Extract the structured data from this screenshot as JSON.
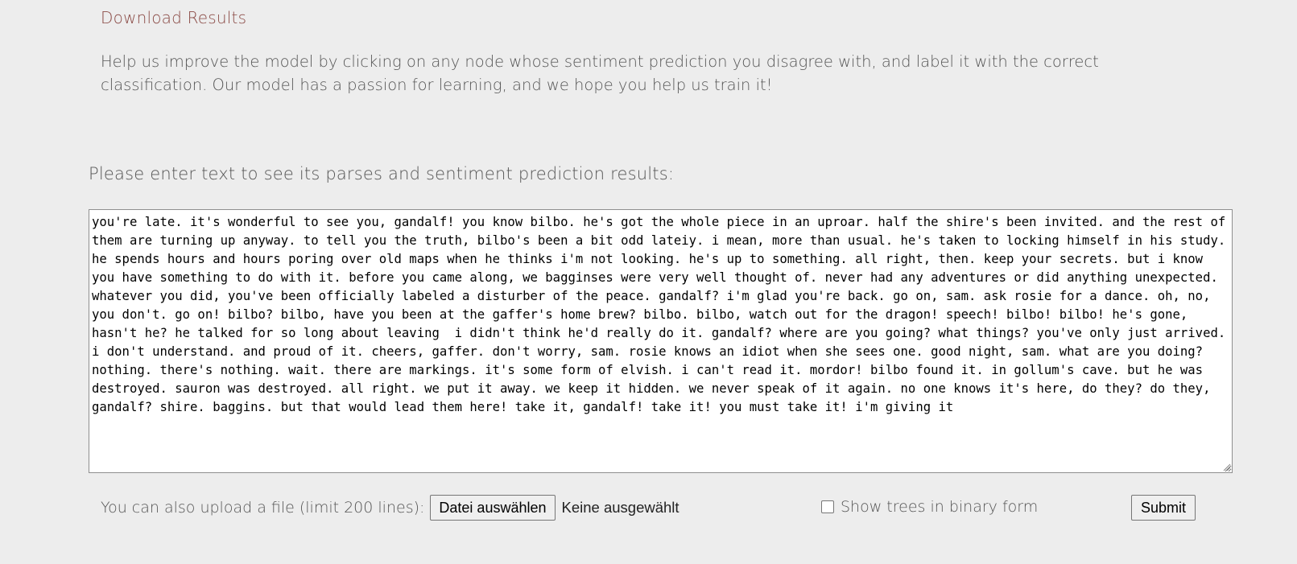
{
  "download": {
    "label": "Download Results"
  },
  "help": {
    "text": "Help us improve the model by clicking on any node whose sentiment prediction you disagree with, and label it with the correct classification. Our model has a passion for learning, and we hope you help us train it!"
  },
  "prompt": {
    "label": "Please enter text to see its parses and sentiment prediction results:"
  },
  "text_input": {
    "value": "you're late. it's wonderful to see you, gandalf! you know bilbo. he's got the whole piece in an uproar. half the shire's been invited. and the rest of them are turning up anyway. to tell you the truth, bilbo's been a bit odd lateiy. i mean, more than usual. he's taken to locking himself in his study. he spends hours and hours poring over old maps when he thinks i'm not looking. he's up to something. all right, then. keep your secrets. but i know you have something to do with it. before you came along, we bagginses were very well thought of. never had any adventures or did anything unexpected. whatever you did, you've been officially labeled a disturber of the peace. gandalf? i'm glad you're back. go on, sam. ask rosie for a dance. oh, no, you don't. go on! bilbo? bilbo, have you been at the gaffer's home brew? bilbo. bilbo, watch out for the dragon! speech! bilbo! bilbo! he's gone, hasn't he? he talked for so long about leaving  i didn't think he'd really do it. gandalf? where are you going? what things? you've only just arrived. i don't understand. and proud of it. cheers, gaffer. don't worry, sam. rosie knows an idiot when she sees one. good night, sam. what are you doing? nothing. there's nothing. wait. there are markings. it's some form of elvish. i can't read it. mordor! bilbo found it. in gollum's cave. but he was destroyed. sauron was destroyed. all right. we put it away. we keep it hidden. we never speak of it again. no one knows it's here, do they? do they, gandalf? shire. baggins. but that would lead them here! take it, gandalf! take it! you must take it! i'm giving it"
  },
  "upload": {
    "label": "You can also upload a file (limit 200 lines):",
    "button_label": "Datei auswählen",
    "status": "Keine ausgewählt"
  },
  "binary": {
    "label": "Show trees in binary form",
    "checked": false
  },
  "submit": {
    "label": "Submit"
  }
}
